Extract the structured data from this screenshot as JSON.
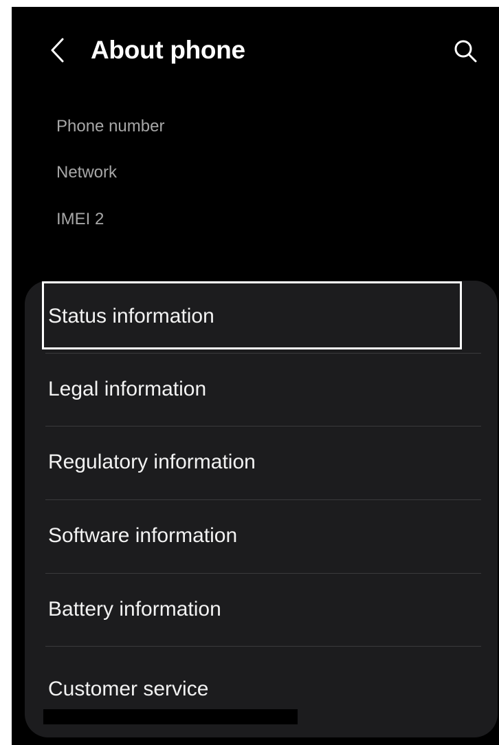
{
  "header": {
    "title": "About phone",
    "back_icon": "chevron-left-icon",
    "search_icon": "search-icon"
  },
  "info_rows": [
    {
      "label": "Phone number"
    },
    {
      "label": "Network"
    },
    {
      "label": "IMEI 2"
    }
  ],
  "menu": {
    "items": [
      {
        "label": "Status information",
        "selected": true
      },
      {
        "label": "Legal information"
      },
      {
        "label": "Regulatory information"
      },
      {
        "label": "Software information"
      },
      {
        "label": "Battery information"
      },
      {
        "label": "Customer service"
      }
    ]
  },
  "colors": {
    "background": "#000000",
    "card": "#1c1c1e",
    "primary_text": "#f2f2f2",
    "secondary_text": "#a7a7a7",
    "divider": "#3a3a3c",
    "highlight_border": "#ffffff"
  }
}
